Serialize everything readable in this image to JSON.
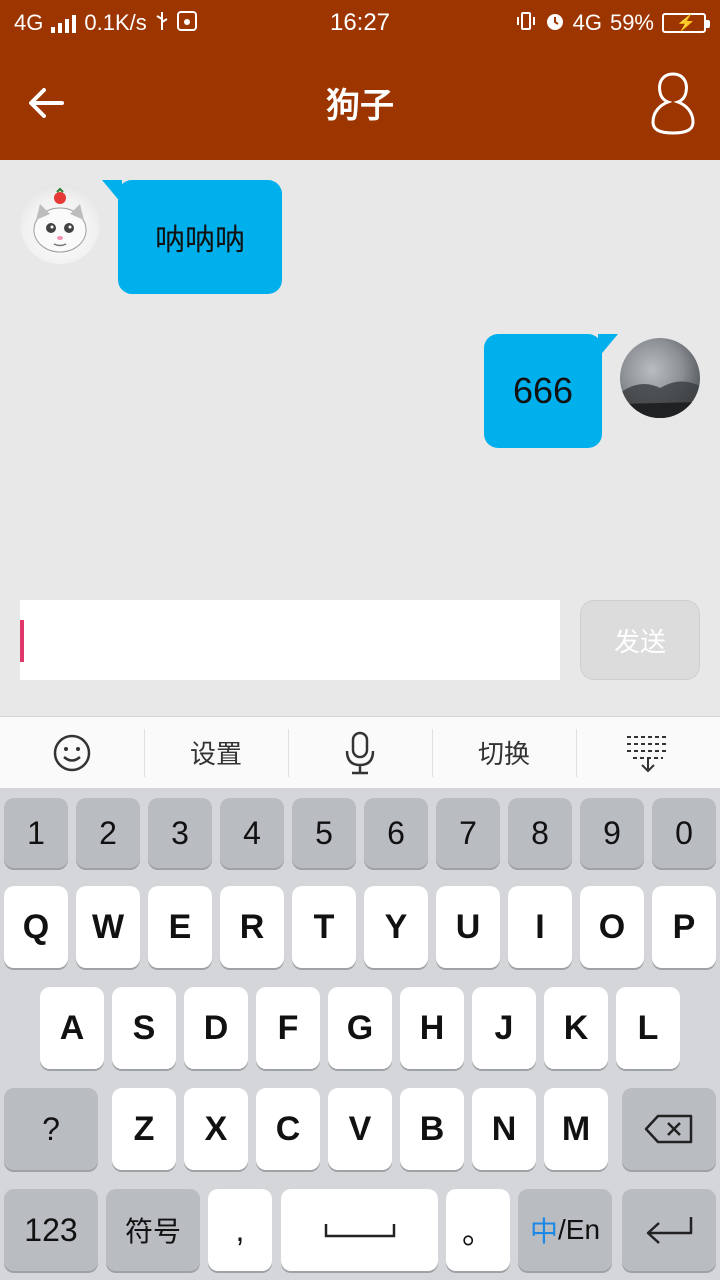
{
  "status_bar": {
    "network_left": "4G",
    "speed": "0.1K/s",
    "time": "16:27",
    "network_right": "4G",
    "battery": "59%"
  },
  "header": {
    "title": "狗子",
    "back_icon": "arrow-left-icon",
    "profile_icon": "person-icon"
  },
  "messages": [
    {
      "side": "left",
      "text": "呐呐呐"
    },
    {
      "side": "right",
      "text": "666"
    }
  ],
  "composer": {
    "input_value": "",
    "send_label": "发送"
  },
  "keyboard_toolbar": {
    "settings_label": "设置",
    "switch_label": "切换"
  },
  "keyboard": {
    "row_numbers": [
      "1",
      "2",
      "3",
      "4",
      "5",
      "6",
      "7",
      "8",
      "9",
      "0"
    ],
    "row_1": [
      "Q",
      "W",
      "E",
      "R",
      "T",
      "Y",
      "U",
      "I",
      "O",
      "P"
    ],
    "row_2": [
      "A",
      "S",
      "D",
      "F",
      "G",
      "H",
      "J",
      "K",
      "L"
    ],
    "row_3": [
      "Z",
      "X",
      "C",
      "V",
      "B",
      "N",
      "M"
    ],
    "question_key": "?",
    "numbers_key": "123",
    "symbols_key": "符号",
    "comma_key": ",",
    "period_key": "。",
    "lang_key_cn": "中",
    "lang_key_en": "/En"
  },
  "colors": {
    "header": "#9c3500",
    "bubble": "#00b0ec",
    "cursor": "#e2376b",
    "lang_accent": "#1e88e5"
  }
}
